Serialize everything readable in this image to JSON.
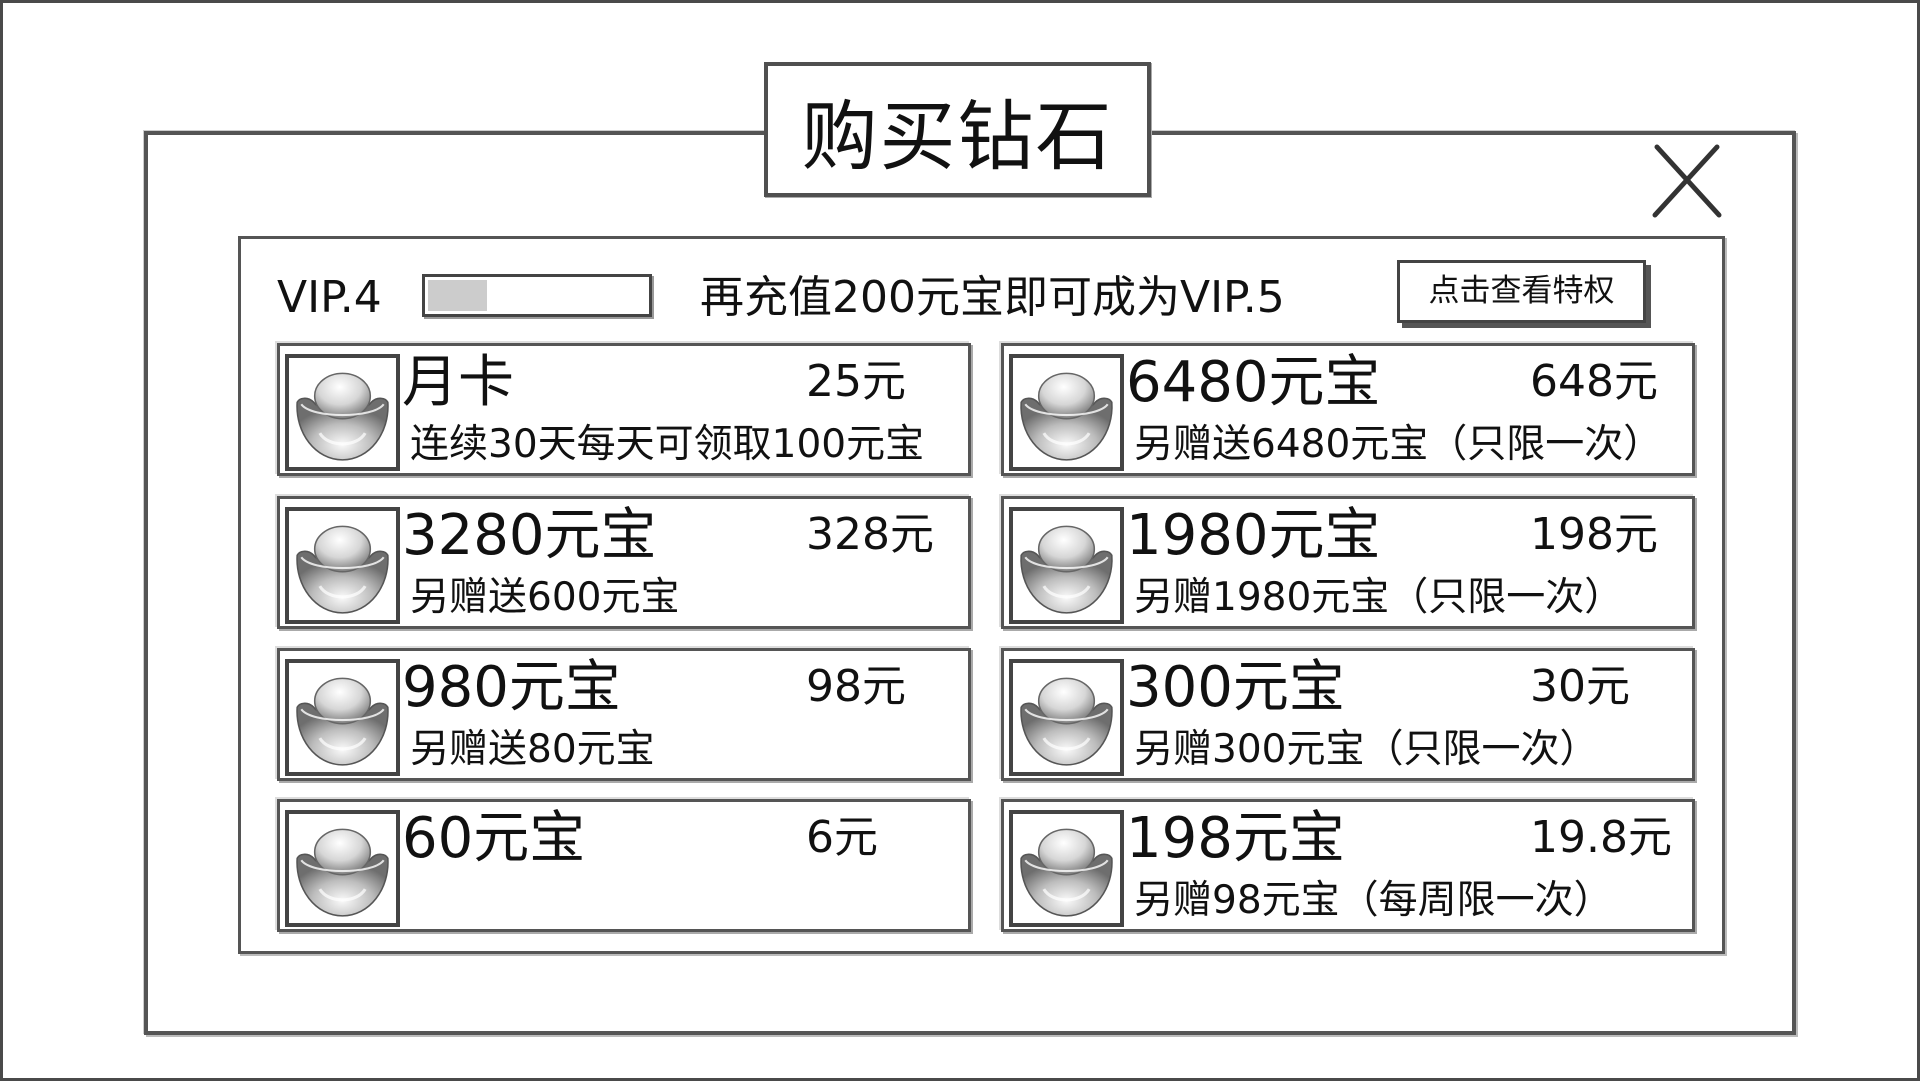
{
  "dialog": {
    "title": "购买钻石",
    "close_icon": "close-icon"
  },
  "vip": {
    "current_level": "VIP.4",
    "progress_fraction": 0.27,
    "hint": "再充值200元宝即可成为VIP.5",
    "privilege_button_label": "点击查看特权"
  },
  "colors": {
    "border": "#555555",
    "progress_fill": "#cccccc",
    "background": "#ffffff"
  },
  "products": {
    "left": [
      {
        "icon": "gold-ingot-icon",
        "name": "月卡",
        "price": "25元",
        "desc": "连续30天每天可领取100元宝"
      },
      {
        "icon": "gold-ingot-icon",
        "name": "3280元宝",
        "price": "328元",
        "desc": "另赠送600元宝"
      },
      {
        "icon": "gold-ingot-icon",
        "name": "980元宝",
        "price": "98元",
        "desc": "另赠送80元宝"
      },
      {
        "icon": "gold-ingot-icon",
        "name": "60元宝",
        "price": "6元",
        "desc": ""
      }
    ],
    "right": [
      {
        "icon": "gold-ingot-icon",
        "name": "6480元宝",
        "price": "648元",
        "desc": "另赠送6480元宝（只限一次）"
      },
      {
        "icon": "gold-ingot-icon",
        "name": "1980元宝",
        "price": "198元",
        "desc": "另赠1980元宝（只限一次）"
      },
      {
        "icon": "gold-ingot-icon",
        "name": "300元宝",
        "price": "30元",
        "desc": "另赠300元宝（只限一次）"
      },
      {
        "icon": "gold-ingot-icon",
        "name": "198元宝",
        "price": "19.8元",
        "desc": "另赠98元宝（每周限一次）"
      }
    ]
  }
}
